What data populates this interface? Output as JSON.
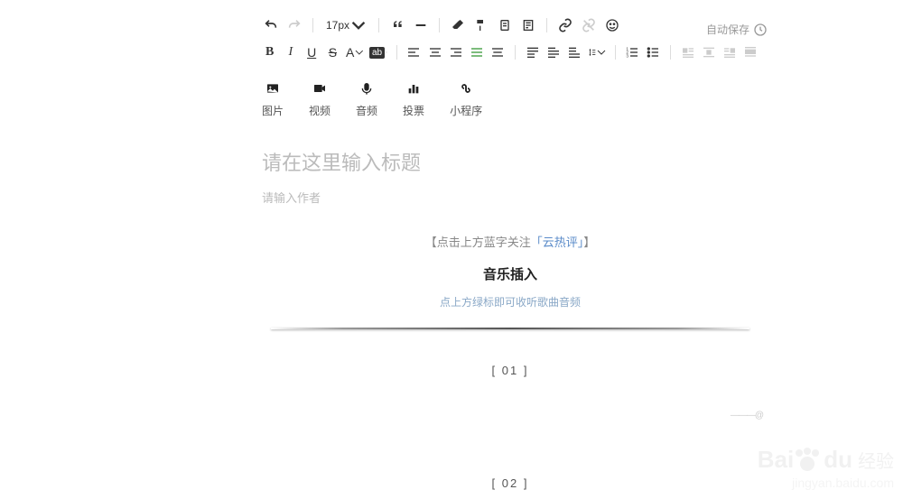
{
  "toolbar": {
    "font_size": "17px",
    "autosave": "自动保存"
  },
  "media": {
    "image": "图片",
    "video": "视频",
    "audio": "音频",
    "vote": "投票",
    "miniapp": "小程序"
  },
  "content": {
    "title_placeholder": "请在这里输入标题",
    "author_placeholder": "请输入作者",
    "follow_prefix": "【点击上方蓝字关注",
    "follow_link": "「云热评」",
    "follow_suffix": "】",
    "music_title": "音乐插入",
    "green_hint": "点上方绿标即可收听歌曲音频",
    "section1": "[ 01 ]",
    "section2": "[ 02 ]"
  },
  "watermark": {
    "brand": "Bai",
    "brand2": "du",
    "cn": "经验",
    "sub": "jingyan.baidu.com"
  },
  "float": "———@"
}
